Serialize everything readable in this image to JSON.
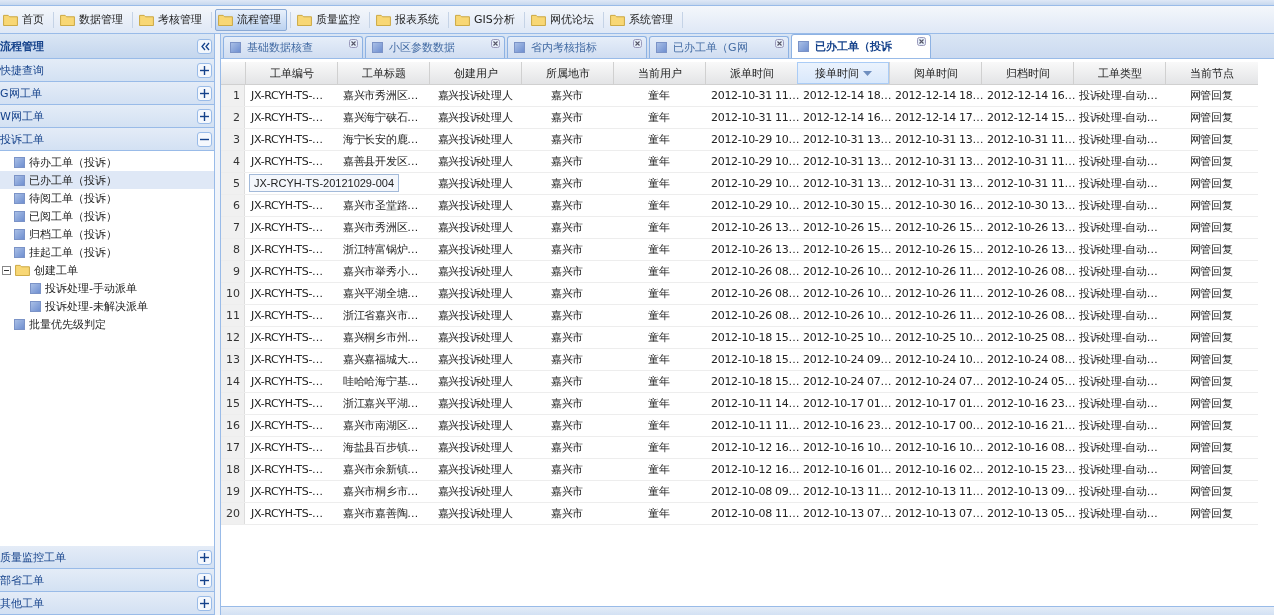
{
  "menu": [
    {
      "label": "首页",
      "selected": false
    },
    {
      "label": "数据管理",
      "selected": false
    },
    {
      "label": "考核管理",
      "selected": false
    },
    {
      "label": "流程管理",
      "selected": true
    },
    {
      "label": "质量监控",
      "selected": false
    },
    {
      "label": "报表系统",
      "selected": false
    },
    {
      "label": "GIS分析",
      "selected": false
    },
    {
      "label": "网优论坛",
      "selected": false
    },
    {
      "label": "系统管理",
      "selected": false
    }
  ],
  "sidebar": {
    "title": "流程管理",
    "sections": [
      {
        "label": "快捷查询",
        "expanded": false
      },
      {
        "label": "G网工单",
        "expanded": false
      },
      {
        "label": "W网工单",
        "expanded": false
      },
      {
        "label": "投诉工单",
        "expanded": true,
        "items": [
          {
            "label": "待办工单（投诉）",
            "selected": false,
            "kind": "leaf"
          },
          {
            "label": "已办工单（投诉）",
            "selected": true,
            "kind": "leaf"
          },
          {
            "label": "待阅工单（投诉）",
            "selected": false,
            "kind": "leaf"
          },
          {
            "label": "已阅工单（投诉）",
            "selected": false,
            "kind": "leaf"
          },
          {
            "label": "归档工单（投诉）",
            "selected": false,
            "kind": "leaf"
          },
          {
            "label": "挂起工单（投诉）",
            "selected": false,
            "kind": "leaf"
          },
          {
            "label": "创建工单",
            "selected": false,
            "kind": "folder",
            "expanded": true,
            "children": [
              {
                "label": "投诉处理-手动派单",
                "selected": false,
                "kind": "leaf"
              },
              {
                "label": "投诉处理-未解决派单",
                "selected": false,
                "kind": "leaf"
              }
            ]
          },
          {
            "label": "批量优先级判定",
            "selected": false,
            "kind": "leaf"
          }
        ]
      }
    ],
    "bottom_sections": [
      {
        "label": "质量监控工单",
        "expanded": false
      },
      {
        "label": "部省工单",
        "expanded": false
      },
      {
        "label": "其他工单",
        "expanded": false
      }
    ]
  },
  "tabs": [
    {
      "label": "基础数据核查",
      "selected": false
    },
    {
      "label": "小区参数数据",
      "selected": false
    },
    {
      "label": "省内考核指标",
      "selected": false
    },
    {
      "label": "已办工单（G网",
      "selected": false
    },
    {
      "label": "已办工单（投诉",
      "selected": true
    }
  ],
  "table": {
    "columns": [
      {
        "label": "工单编号",
        "sorted": false
      },
      {
        "label": "工单标题",
        "sorted": false
      },
      {
        "label": "创建用户",
        "sorted": false
      },
      {
        "label": "所属地市",
        "sorted": false
      },
      {
        "label": "当前用户",
        "sorted": false
      },
      {
        "label": "派单时间",
        "sorted": false
      },
      {
        "label": "接单时间",
        "sorted": true
      },
      {
        "label": "阅单时间",
        "sorted": false
      },
      {
        "label": "归档时间",
        "sorted": false
      },
      {
        "label": "工单类型",
        "sorted": false
      },
      {
        "label": "当前节点",
        "sorted": false
      }
    ],
    "rows": [
      {
        "number": "1",
        "cells": [
          "JX-RCYH-TS-…",
          "嘉兴市秀洲区…",
          "嘉兴投诉处理人",
          "嘉兴市",
          "童年",
          "2012-10-31 11…",
          "2012-12-14 18…",
          "2012-12-14 18…",
          "2012-12-14 16…",
          "投诉处理-自动…",
          "网管回复"
        ]
      },
      {
        "number": "2",
        "cells": [
          "JX-RCYH-TS-…",
          "嘉兴海宁硖石…",
          "嘉兴投诉处理人",
          "嘉兴市",
          "童年",
          "2012-10-31 11…",
          "2012-12-14 16…",
          "2012-12-14 17…",
          "2012-12-14 15…",
          "投诉处理-自动…",
          "网管回复"
        ]
      },
      {
        "number": "3",
        "cells": [
          "JX-RCYH-TS-…",
          "海宁长安的鹿…",
          "嘉兴投诉处理人",
          "嘉兴市",
          "童年",
          "2012-10-29 10…",
          "2012-10-31 13…",
          "2012-10-31 13…",
          "2012-10-31 11…",
          "投诉处理-自动…",
          "网管回复"
        ]
      },
      {
        "number": "4",
        "cells": [
          "JX-RCYH-TS-…",
          "嘉善县开发区…",
          "嘉兴投诉处理人",
          "嘉兴市",
          "童年",
          "2012-10-29 10…",
          "2012-10-31 13…",
          "2012-10-31 13…",
          "2012-10-31 11…",
          "投诉处理-自动…",
          "网管回复"
        ]
      },
      {
        "number": "5",
        "cells": [
          null,
          null,
          "嘉兴投诉处理人",
          "嘉兴市",
          "童年",
          "2012-10-29 10…",
          "2012-10-31 13…",
          "2012-10-31 13…",
          "2012-10-31 11…",
          "投诉处理-自动…",
          "网管回复"
        ]
      },
      {
        "number": "6",
        "cells": [
          "JX-RCYH-TS-…",
          "嘉兴市圣堂路…",
          "嘉兴投诉处理人",
          "嘉兴市",
          "童年",
          "2012-10-29 10…",
          "2012-10-30 15…",
          "2012-10-30 16…",
          "2012-10-30 13…",
          "投诉处理-自动…",
          "网管回复"
        ]
      },
      {
        "number": "7",
        "cells": [
          "JX-RCYH-TS-…",
          "嘉兴市秀洲区…",
          "嘉兴投诉处理人",
          "嘉兴市",
          "童年",
          "2012-10-26 13…",
          "2012-10-26 15…",
          "2012-10-26 15…",
          "2012-10-26 13…",
          "投诉处理-自动…",
          "网管回复"
        ]
      },
      {
        "number": "8",
        "cells": [
          "JX-RCYH-TS-…",
          "浙江特富锅炉…",
          "嘉兴投诉处理人",
          "嘉兴市",
          "童年",
          "2012-10-26 13…",
          "2012-10-26 15…",
          "2012-10-26 15…",
          "2012-10-26 13…",
          "投诉处理-自动…",
          "网管回复"
        ]
      },
      {
        "number": "9",
        "cells": [
          "JX-RCYH-TS-…",
          "嘉兴市举秀小…",
          "嘉兴投诉处理人",
          "嘉兴市",
          "童年",
          "2012-10-26 08…",
          "2012-10-26 10…",
          "2012-10-26 11…",
          "2012-10-26 08…",
          "投诉处理-自动…",
          "网管回复"
        ]
      },
      {
        "number": "10",
        "cells": [
          "JX-RCYH-TS-…",
          "嘉兴平湖全塘…",
          "嘉兴投诉处理人",
          "嘉兴市",
          "童年",
          "2012-10-26 08…",
          "2012-10-26 10…",
          "2012-10-26 11…",
          "2012-10-26 08…",
          "投诉处理-自动…",
          "网管回复"
        ]
      },
      {
        "number": "11",
        "cells": [
          "JX-RCYH-TS-…",
          "浙江省嘉兴市…",
          "嘉兴投诉处理人",
          "嘉兴市",
          "童年",
          "2012-10-26 08…",
          "2012-10-26 10…",
          "2012-10-26 11…",
          "2012-10-26 08…",
          "投诉处理-自动…",
          "网管回复"
        ]
      },
      {
        "number": "12",
        "cells": [
          "JX-RCYH-TS-…",
          "嘉兴桐乡市州…",
          "嘉兴投诉处理人",
          "嘉兴市",
          "童年",
          "2012-10-18 15…",
          "2012-10-25 10…",
          "2012-10-25 10…",
          "2012-10-25 08…",
          "投诉处理-自动…",
          "网管回复"
        ]
      },
      {
        "number": "13",
        "cells": [
          "JX-RCYH-TS-…",
          "嘉兴嘉福城大…",
          "嘉兴投诉处理人",
          "嘉兴市",
          "童年",
          "2012-10-18 15…",
          "2012-10-24 09…",
          "2012-10-24 10…",
          "2012-10-24 08…",
          "投诉处理-自动…",
          "网管回复"
        ]
      },
      {
        "number": "14",
        "cells": [
          "JX-RCYH-TS-…",
          "哇哈哈海宁基…",
          "嘉兴投诉处理人",
          "嘉兴市",
          "童年",
          "2012-10-18 15…",
          "2012-10-24 07…",
          "2012-10-24 07…",
          "2012-10-24 05…",
          "投诉处理-自动…",
          "网管回复"
        ]
      },
      {
        "number": "15",
        "cells": [
          "JX-RCYH-TS-…",
          "浙江嘉兴平湖…",
          "嘉兴投诉处理人",
          "嘉兴市",
          "童年",
          "2012-10-11 14…",
          "2012-10-17 01…",
          "2012-10-17 01…",
          "2012-10-16 23…",
          "投诉处理-自动…",
          "网管回复"
        ]
      },
      {
        "number": "16",
        "cells": [
          "JX-RCYH-TS-…",
          "嘉兴市南湖区…",
          "嘉兴投诉处理人",
          "嘉兴市",
          "童年",
          "2012-10-11 11…",
          "2012-10-16 23…",
          "2012-10-17 00…",
          "2012-10-16 21…",
          "投诉处理-自动…",
          "网管回复"
        ]
      },
      {
        "number": "17",
        "cells": [
          "JX-RCYH-TS-…",
          "海盐县百步镇…",
          "嘉兴投诉处理人",
          "嘉兴市",
          "童年",
          "2012-10-12 16…",
          "2012-10-16 10…",
          "2012-10-16 10…",
          "2012-10-16 08…",
          "投诉处理-自动…",
          "网管回复"
        ]
      },
      {
        "number": "18",
        "cells": [
          "JX-RCYH-TS-…",
          "嘉兴市余新镇…",
          "嘉兴投诉处理人",
          "嘉兴市",
          "童年",
          "2012-10-12 16…",
          "2012-10-16 01…",
          "2012-10-16 02…",
          "2012-10-15 23…",
          "投诉处理-自动…",
          "网管回复"
        ]
      },
      {
        "number": "19",
        "cells": [
          "JX-RCYH-TS-…",
          "嘉兴市桐乡市…",
          "嘉兴投诉处理人",
          "嘉兴市",
          "童年",
          "2012-10-08 09…",
          "2012-10-13 11…",
          "2012-10-13 11…",
          "2012-10-13 09…",
          "投诉处理-自动…",
          "网管回复"
        ]
      },
      {
        "number": "20",
        "cells": [
          "JX-RCYH-TS-…",
          "嘉兴市嘉善陶…",
          "嘉兴投诉处理人",
          "嘉兴市",
          "童年",
          "2012-10-08 11…",
          "2012-10-13 07…",
          "2012-10-13 07…",
          "2012-10-13 05…",
          "投诉处理-自动…",
          "网管回复"
        ]
      }
    ]
  },
  "tooltip": {
    "text": "JX-RCYH-TS-20121029-004"
  }
}
